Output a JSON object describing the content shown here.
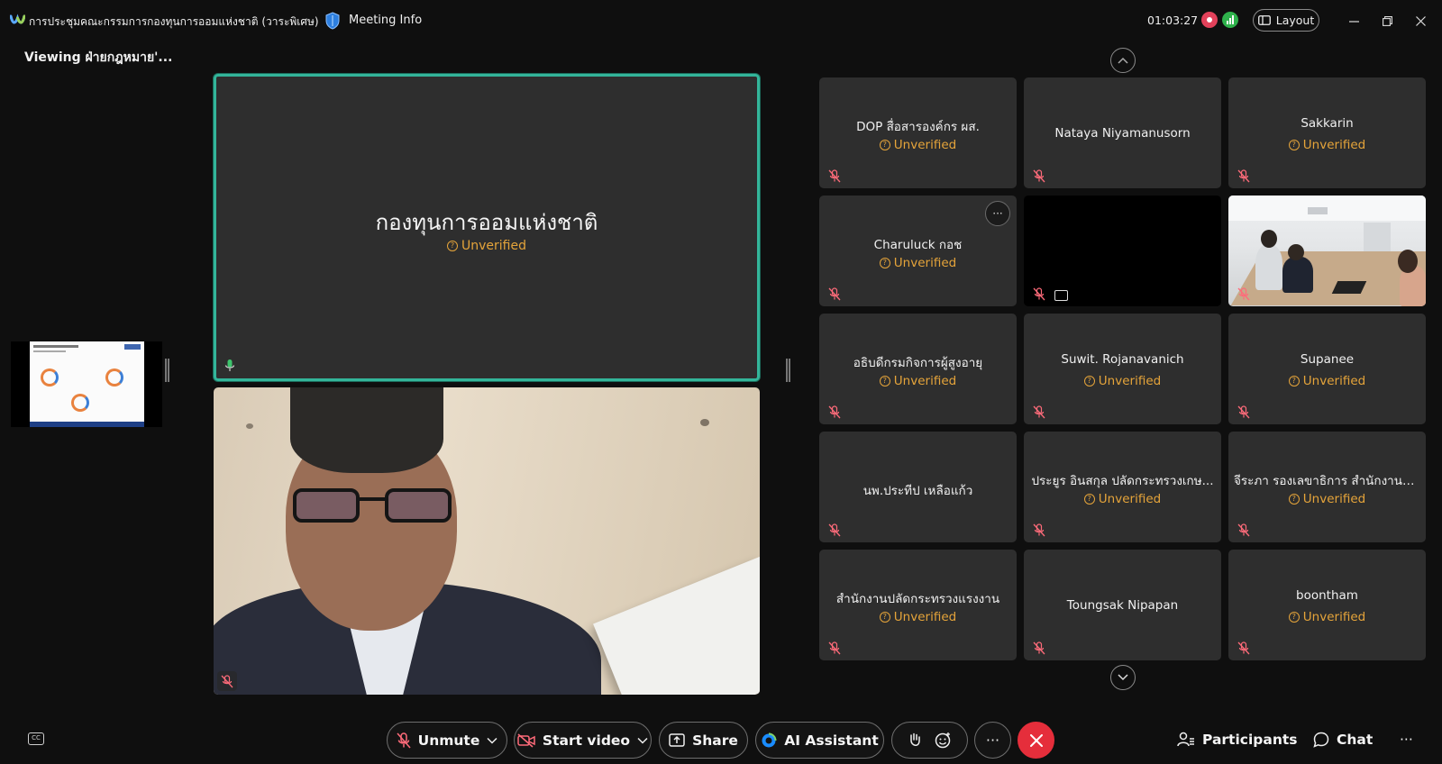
{
  "titlebar": {
    "meeting_title": "การประชุมคณะกรรมการกองทุนการออมแห่งชาติ (วาระพิเศษ)",
    "meeting_info_label": "Meeting Info",
    "timer": "01:03:27",
    "layout_label": "Layout",
    "icons": [
      "webex-logo-icon",
      "shield-icon",
      "record-icon",
      "network-icon",
      "layout-icon",
      "minimize-icon",
      "restore-icon",
      "close-icon"
    ]
  },
  "viewing_label": "Viewing ฝ่ายกฎหมาย'...",
  "active_speaker": {
    "name": "กองทุนการออมแห่งชาติ",
    "status": "Unverified"
  },
  "status_color": "#e5a43a",
  "accent_color": "#33b59a",
  "leave_color": "#e52e3b",
  "participants": [
    {
      "name": "DOP สื่อสารองค์กร ผส.",
      "status": "Unverified",
      "muted": true
    },
    {
      "name": "Nataya Niyamanusorn",
      "status": "",
      "muted": true
    },
    {
      "name": "Sakkarin",
      "status": "Unverified",
      "muted": true
    },
    {
      "name": "Charuluck กอช",
      "status": "Unverified",
      "muted": true
    },
    {
      "name": "",
      "status": "",
      "muted": true
    },
    {
      "name": "",
      "status": "",
      "muted": true
    },
    {
      "name": "อธิบดีกรมกิจการผู้สูงอายุ",
      "status": "Unverified",
      "muted": true
    },
    {
      "name": "Suwit. Rojanavanich",
      "status": "Unverified",
      "muted": true
    },
    {
      "name": "Supanee",
      "status": "Unverified",
      "muted": true
    },
    {
      "name": "นพ.ประทีป เหลือแก้ว",
      "status": "",
      "muted": true
    },
    {
      "name": "ประยูร อินสกุล ปลัดกระทรวงเกษ...",
      "status": "Unverified",
      "muted": true
    },
    {
      "name": "จีระภา รองเลขาธิการ สำนักงานป...",
      "status": "Unverified",
      "muted": true
    },
    {
      "name": "สำนักงานปลัดกระทรวงแรงงาน",
      "status": "Unverified",
      "muted": true
    },
    {
      "name": "Toungsak Nipapan",
      "status": "",
      "muted": true
    },
    {
      "name": "boontham",
      "status": "Unverified",
      "muted": true
    }
  ],
  "tile_more_label": "···",
  "controls": {
    "unmute": "Unmute",
    "start_video": "Start video",
    "share": "Share",
    "ai_assistant": "AI Assistant",
    "more": "···",
    "participants": "Participants",
    "chat": "Chat",
    "overflow": "···",
    "cc": "CC"
  }
}
